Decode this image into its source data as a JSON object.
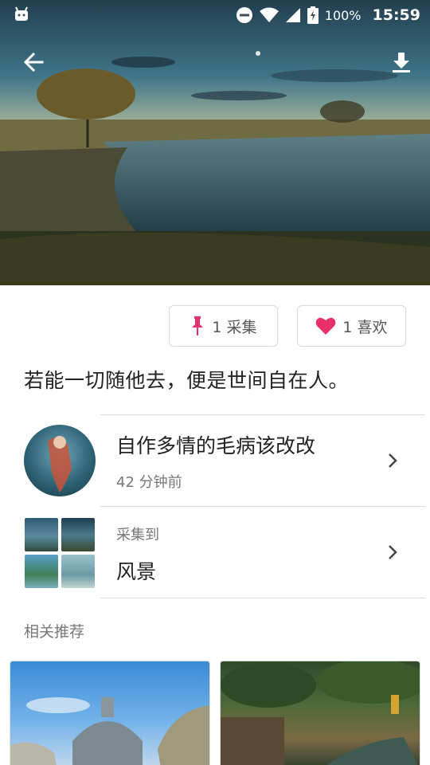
{
  "status_bar": {
    "battery_percent": "100%",
    "time": "15:59"
  },
  "pin": {
    "collect_label": "1 采集",
    "like_label": "1 喜欢",
    "description": "若能一切随他去，便是世间自在人。"
  },
  "author": {
    "name": "自作多情的毛病该改改",
    "posted": "42 分钟前"
  },
  "board": {
    "caption": "采集到",
    "name": "风景"
  },
  "related": {
    "title": "相关推荐"
  },
  "colors": {
    "accent": "#e8306a",
    "divider": "#dedede",
    "secondary_text": "#777777"
  },
  "icons": [
    "android-icon",
    "dnd-icon",
    "wifi-icon",
    "signal-icon",
    "battery-icon",
    "back-arrow-icon",
    "download-icon",
    "pin-icon",
    "heart-icon",
    "chevron-right-icon"
  ]
}
